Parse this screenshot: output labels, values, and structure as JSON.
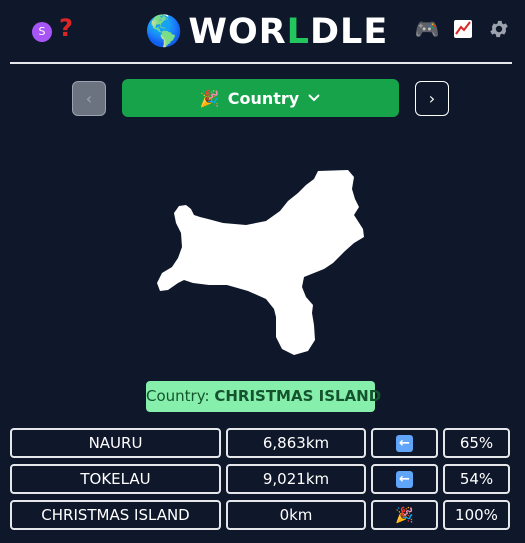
{
  "header": {
    "avatar_letter": "S",
    "help_icon": "?",
    "title_prefix": "WOR",
    "title_mid": "L",
    "title_suffix": "DLE",
    "icons": [
      "globe-icon",
      "gamepad-icon",
      "stats-icon",
      "gear-icon"
    ]
  },
  "nav": {
    "prev": "‹",
    "mode_label": "Country",
    "next": "›"
  },
  "answer": {
    "prefix": "Country: ",
    "name": "CHRISTMAS ISLAND"
  },
  "guesses": [
    {
      "name": "NAURU",
      "distance": "6,863km",
      "direction": "⬅",
      "percent": "65%",
      "direction_icon": "left-arrow-icon"
    },
    {
      "name": "TOKELAU",
      "distance": "9,021km",
      "direction": "⬅",
      "percent": "54%",
      "direction_icon": "left-arrow-icon"
    },
    {
      "name": "CHRISTMAS ISLAND",
      "distance": "0km",
      "direction": "🎉",
      "percent": "100%",
      "direction_icon": "party-popper-icon"
    }
  ],
  "colors": {
    "background": "#0f172a",
    "accent_green": "#16a34a",
    "answer_bg": "#86efac",
    "answer_text": "#14532d"
  }
}
